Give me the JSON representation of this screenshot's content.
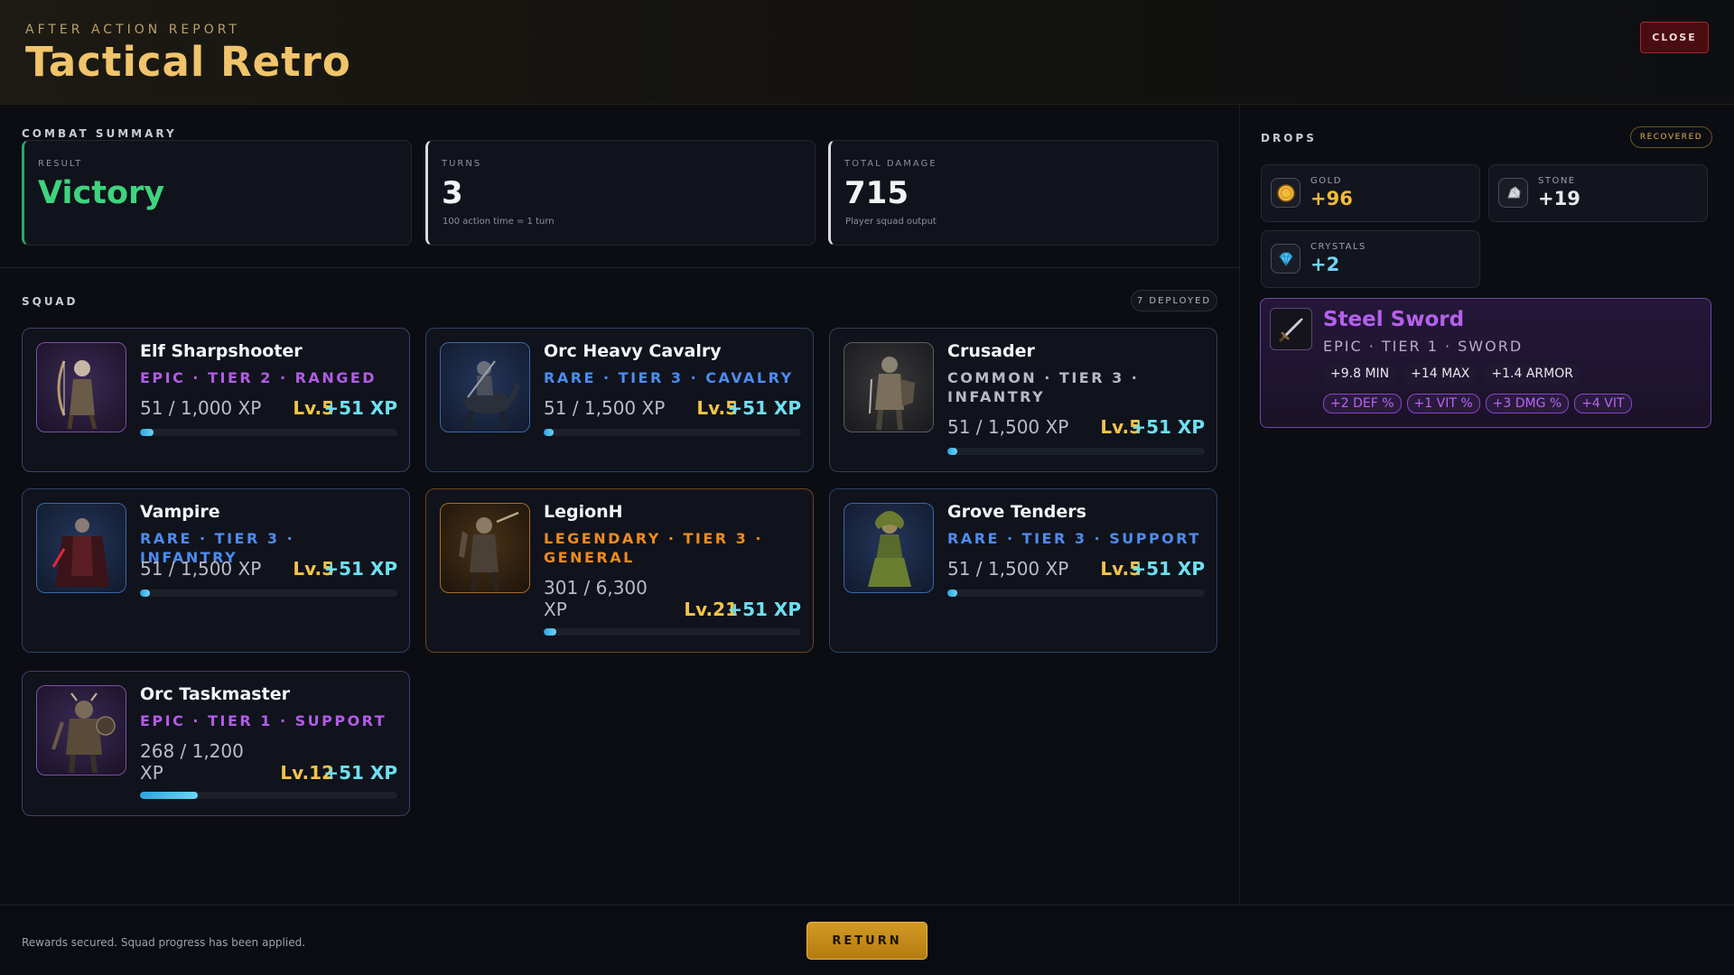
{
  "header": {
    "kicker": "AFTER ACTION REPORT",
    "title": "Tactical Retro",
    "close_label": "CLOSE"
  },
  "summary": {
    "label": "COMBAT SUMMARY",
    "result": {
      "label": "RESULT",
      "value": "Victory"
    },
    "turns": {
      "label": "TURNS",
      "value": "3",
      "sub": "100 action time = 1 turn"
    },
    "damage": {
      "label": "TOTAL DAMAGE",
      "value": "715",
      "sub": "Player squad output"
    }
  },
  "squad": {
    "label": "SQUAD",
    "deployed": "7 DEPLOYED",
    "units": [
      {
        "name": "Elf Sharpshooter",
        "tags": "EPIC · TIER 2 · RANGED",
        "xp": "51 / 1,000 XP",
        "level": "Lv.5",
        "gain": "+51 XP",
        "progress": 0.051,
        "rarity": "epic",
        "portrait": "archer"
      },
      {
        "name": "Orc Heavy Cavalry",
        "tags": "RARE · TIER 3 · CAVALRY",
        "xp": "51 / 1,500 XP",
        "level": "Lv.5",
        "gain": "+51 XP",
        "progress": 0.034,
        "rarity": "rare",
        "portrait": "rider"
      },
      {
        "name": "Crusader",
        "tags": "COMMON · TIER 3 · INFANTRY",
        "xp": "51 / 1,500 XP",
        "level": "Lv.5",
        "gain": "+51 XP",
        "progress": 0.034,
        "rarity": "common",
        "portrait": "knight"
      },
      {
        "name": "Vampire",
        "tags": "RARE · TIER 3 · INFANTRY",
        "xp": "51 / 1,500 XP",
        "level": "Lv.5",
        "gain": "+51 XP",
        "progress": 0.034,
        "rarity": "rare",
        "portrait": "vampire"
      },
      {
        "name": "LegionH",
        "tags": "LEGENDARY · TIER 3 · GENERAL",
        "xp": "301 / 6,300 XP",
        "level": "Lv.21",
        "gain": "+51 XP",
        "progress": 0.048,
        "rarity": "legend",
        "portrait": "general"
      },
      {
        "name": "Grove Tenders",
        "tags": "RARE · TIER 3 · SUPPORT",
        "xp": "51 / 1,500 XP",
        "level": "Lv.5",
        "gain": "+51 XP",
        "progress": 0.034,
        "rarity": "rare",
        "portrait": "dryad"
      },
      {
        "name": "Orc Taskmaster",
        "tags": "EPIC · TIER 1 · SUPPORT",
        "xp": "268 / 1,200 XP",
        "level": "Lv.12",
        "gain": "+51 XP",
        "progress": 0.223,
        "rarity": "epic",
        "portrait": "orc"
      }
    ]
  },
  "drops": {
    "label": "DROPS",
    "recovered": "RECOVERED",
    "gold": {
      "label": "GOLD",
      "value": "+96",
      "color": "#f2b93a"
    },
    "stone": {
      "label": "STONE",
      "value": "+19",
      "color": "#e8e8ec"
    },
    "crystals": {
      "label": "CRYSTALS",
      "value": "+2",
      "color": "#6fd3f5"
    },
    "item": {
      "name": "Steel Sword",
      "sub": "EPIC · TIER 1 · SWORD",
      "stats": [
        "+9.8 MIN",
        "+14 MAX",
        "+1.4 ARMOR"
      ],
      "bonuses": [
        "+2 DEF %",
        "+1 VIT %",
        "+3 DMG %",
        "+4 VIT"
      ],
      "icon": "sword-icon"
    }
  },
  "footer": {
    "text": "Rewards secured. Squad progress has been applied.",
    "return_label": "RETURN"
  }
}
